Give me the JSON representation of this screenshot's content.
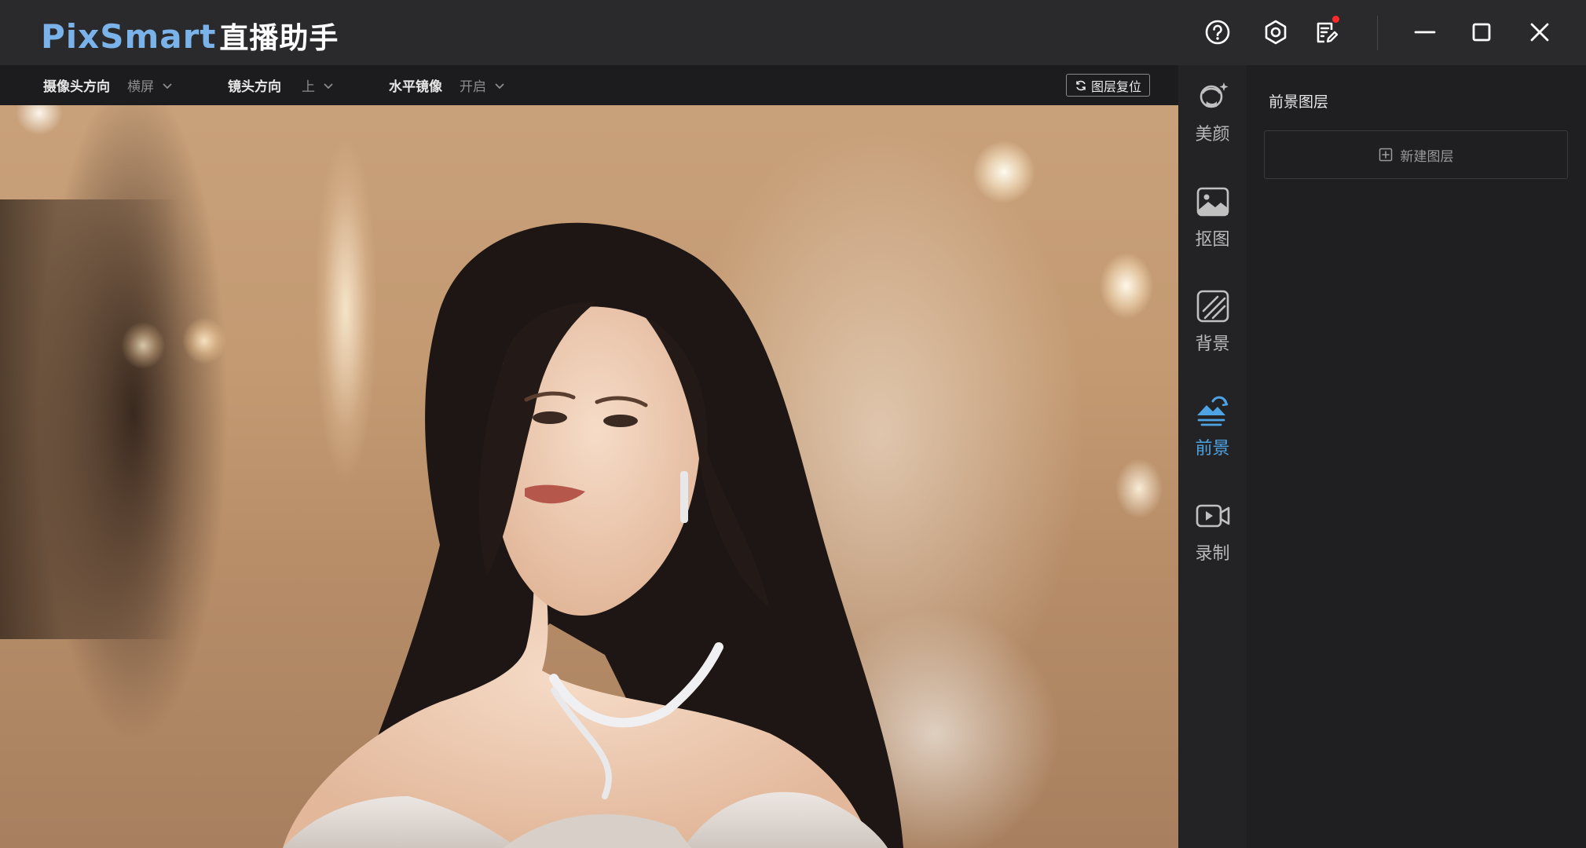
{
  "app": {
    "brand": "PixSmart",
    "brand_suffix": "直播助手"
  },
  "toolbar": {
    "camera_orientation": {
      "label": "摄像头方向",
      "value": "横屏"
    },
    "lens_direction": {
      "label": "镜头方向",
      "value": "上"
    },
    "horizontal_mirror": {
      "label": "水平镜像",
      "value": "开启"
    },
    "reset_layers_label": "图层复位"
  },
  "titlebar": {
    "icons": [
      "help-icon",
      "settings-icon",
      "notes-icon"
    ],
    "notification_dot_color": "#ff2a2a",
    "window_controls": [
      "minimize-icon",
      "maximize-icon",
      "close-icon"
    ]
  },
  "sidenav": {
    "items": [
      {
        "id": "beauty",
        "label": "美颜",
        "icon": "face-beauty-icon",
        "active": false
      },
      {
        "id": "cutout",
        "label": "抠图",
        "icon": "image-cutout-icon",
        "active": false
      },
      {
        "id": "background",
        "label": "背景",
        "icon": "background-icon",
        "active": false
      },
      {
        "id": "foreground",
        "label": "前景",
        "icon": "foreground-icon",
        "active": true
      },
      {
        "id": "record",
        "label": "录制",
        "icon": "video-record-icon",
        "active": false
      }
    ],
    "active_color": "#4ea3e3"
  },
  "right_panel": {
    "title": "前景图层",
    "new_layer_label": "新建图层"
  },
  "colors": {
    "brand_blue": "#79b3ea",
    "titlebar_bg": "#2a2a2c",
    "panel_bg": "#1f1f21"
  }
}
